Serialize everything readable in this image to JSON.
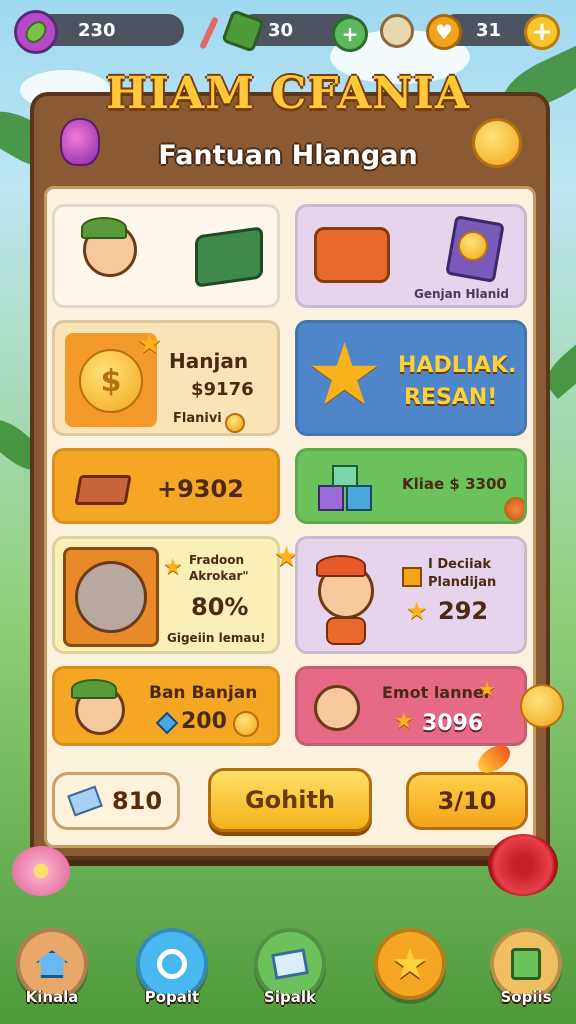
{
  "hud": {
    "gems_value": "230",
    "cash_value": "30",
    "hearts_value": "31"
  },
  "header": {
    "title": "HIAM CFANIA",
    "subtitle": "Fantuan Hlangan"
  },
  "cards": {
    "c1": {},
    "c2": {
      "caption": "Genjan Hlanid"
    },
    "c3": {
      "title": "Hanjan",
      "value": "$9176",
      "note": "Flanivi"
    },
    "c4": {
      "line1": "HADLIAK.",
      "line2": "RESAN!"
    },
    "c5": {
      "value": "+9302"
    },
    "c6": {
      "value": "Kliae $ 3300"
    },
    "c7": {
      "line1": "Fradoon",
      "line2": "Akrokar\"",
      "value": "80%",
      "caption": "Gigeiin lemau!"
    },
    "c8": {
      "line1": "I Deciiak",
      "line2": "Plandijan",
      "value": "292"
    },
    "c9": {
      "title": "Ban Banjan",
      "value": "200"
    },
    "c10": {
      "title": "Emot lannel",
      "value": "3096"
    }
  },
  "buttons": {
    "left_value": "810",
    "main_label": "Gohith",
    "right_value": "3/10"
  },
  "nav": {
    "home": "Kinala",
    "popait": "Popait",
    "sipalk": "Sipalk",
    "star": "",
    "sopiis": "Sopiis"
  },
  "colors": {
    "board_wood": "#8a5a35",
    "accent_gold": "#f2b21a",
    "card_blue": "#4f86c9",
    "card_green": "#6cc25a",
    "card_pink": "#e66a84"
  }
}
